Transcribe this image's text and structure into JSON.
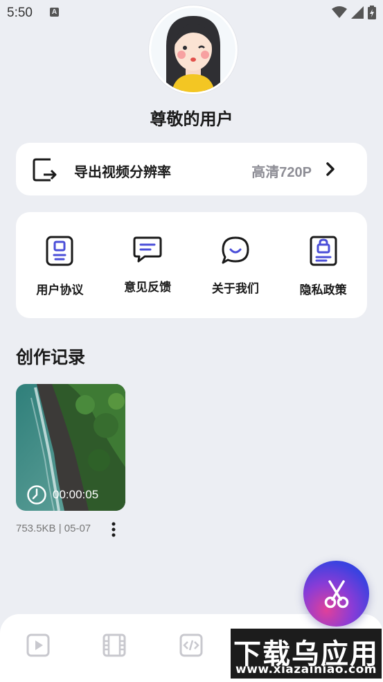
{
  "status_bar": {
    "time": "5:50",
    "notification_badge": "A"
  },
  "profile": {
    "username": "尊敬的用户"
  },
  "resolution": {
    "label": "导出视频分辨率",
    "value": "高清720P"
  },
  "menu": [
    {
      "label": "用户协议",
      "icon": "user-agreement-icon"
    },
    {
      "label": "意见反馈",
      "icon": "feedback-icon"
    },
    {
      "label": "关于我们",
      "icon": "about-us-icon"
    },
    {
      "label": "隐私政策",
      "icon": "privacy-policy-icon"
    }
  ],
  "records": {
    "title": "创作记录",
    "items": [
      {
        "duration": "00:00:05",
        "meta": "753.5KB | 05-07"
      }
    ]
  },
  "bottom_nav": [
    {
      "icon": "play-icon"
    },
    {
      "icon": "film-icon"
    },
    {
      "icon": "code-icon"
    },
    {
      "icon": "profile-icon"
    }
  ],
  "watermark": {
    "text": "下载乌应用",
    "url": "www.xiazainiao.com"
  },
  "colors": {
    "accent": "#4a4ed8",
    "background": "#eceef3",
    "card": "#ffffff"
  }
}
